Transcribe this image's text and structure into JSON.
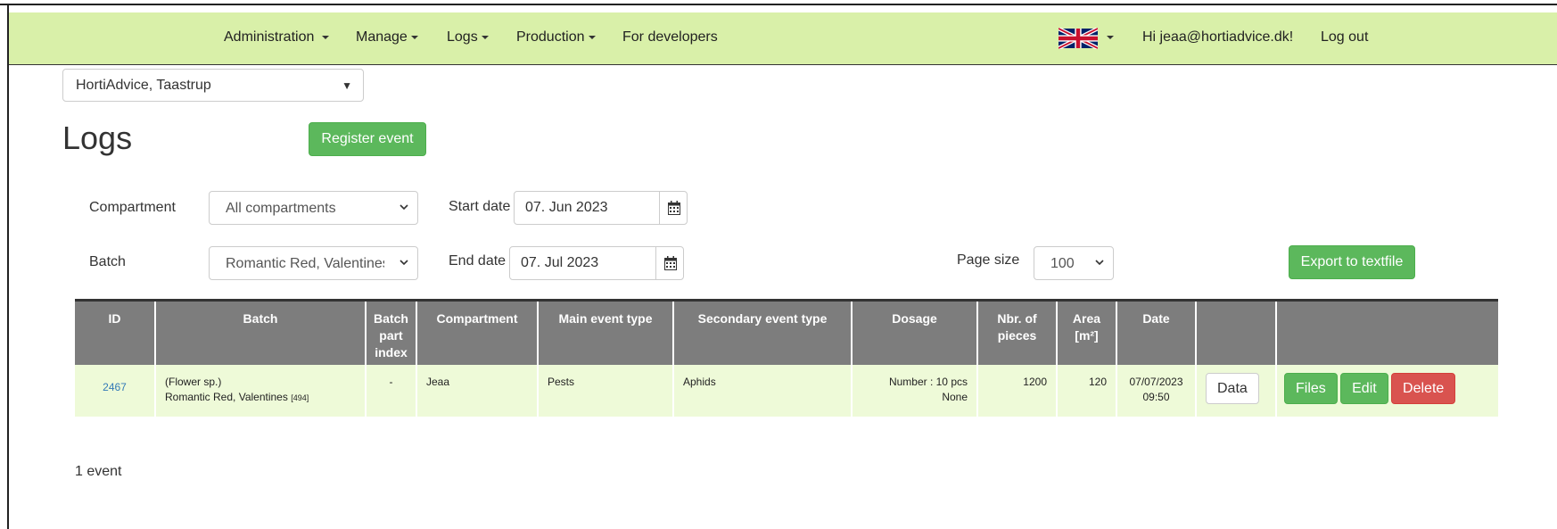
{
  "nav": {
    "items": [
      "Administration",
      "Manage",
      "Logs",
      "Production",
      "For developers"
    ],
    "language_icon": "uk-flag-icon",
    "greeting": "Hi jeaa@hortiadvice.dk!",
    "logout": "Log out"
  },
  "org_select": {
    "value": "HortiAdvice, Taastrup"
  },
  "page_title": "Logs",
  "register_button": "Register event",
  "filters": {
    "compartment_label": "Compartment",
    "compartment_value": "All compartments",
    "batch_label": "Batch",
    "batch_value": "Romantic Red, Valentines",
    "start_date_label": "Start date",
    "start_date_value": "07. Jun 2023",
    "end_date_label": "End date",
    "end_date_value": "07. Jul 2023",
    "page_size_label": "Page size",
    "page_size_value": "100",
    "export_button": "Export to textfile"
  },
  "table": {
    "headers": [
      "ID",
      "Batch",
      "Batch part index",
      "Compartment",
      "Main event type",
      "Secondary event type",
      "Dosage",
      "Nbr. of pieces",
      "Area [m²]",
      "Date",
      "",
      ""
    ],
    "rows": [
      {
        "id": "2467",
        "batch_line1": "(Flower sp.)",
        "batch_line2": "Romantic Red, Valentines",
        "batch_code": "[494]",
        "part_index": "-",
        "compartment": "Jeaa",
        "main_event": "Pests",
        "secondary_event": "Aphids",
        "dosage_line1": "Number : 10 pcs",
        "dosage_line2": "None",
        "pieces": "1200",
        "area": "120",
        "date_line1": "07/07/2023",
        "date_line2": "09:50",
        "data_button": "Data",
        "files_button": "Files",
        "edit_button": "Edit",
        "delete_button": "Delete"
      }
    ]
  },
  "event_count": "1 event",
  "colors": {
    "navbar": "#d9f0a9",
    "green_button": "#5cb85c",
    "red_button": "#d9534f",
    "table_header": "#7d7d7d",
    "row_bg": "#eefad8",
    "link": "#337ab7"
  }
}
